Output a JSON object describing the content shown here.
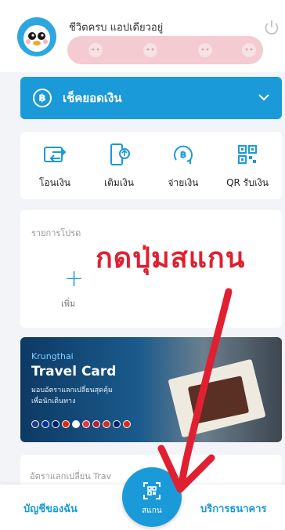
{
  "header": {
    "greeting": "ชีวิตครบ แอปเดียวอยู่"
  },
  "balance": {
    "label": "เช็คยอดเงิน",
    "icon": "baht-icon"
  },
  "actions": [
    {
      "label": "โอนเงิน",
      "icon": "transfer-icon"
    },
    {
      "label": "เติมเงิน",
      "icon": "topup-icon"
    },
    {
      "label": "จ่ายเงิน",
      "icon": "pay-icon"
    },
    {
      "label": "QR รับเงิน",
      "icon": "qr-icon"
    }
  ],
  "favorites": {
    "title": "รายการโปรด",
    "add_label": "เพิ่ม"
  },
  "annotation": {
    "text": "กดปุ่มสแกน",
    "color": "#e02030"
  },
  "banner": {
    "brand": "Krungthai",
    "title": "Travel Card",
    "subtitle_line1": "มอบอัตราแลกเปลี่ยนสุดคุ้ม",
    "subtitle_line2": "เพื่อนักเดินทาง"
  },
  "exchange": {
    "title": "อัตราแลกเปลี่ยน Trav"
  },
  "bottom_nav": {
    "left_label": "บัญชีของฉัน",
    "scan_label": "สแกน",
    "right_label": "บริการธนาคาร"
  },
  "colors": {
    "accent": "#1a9ad8",
    "annotation": "#e02030"
  }
}
